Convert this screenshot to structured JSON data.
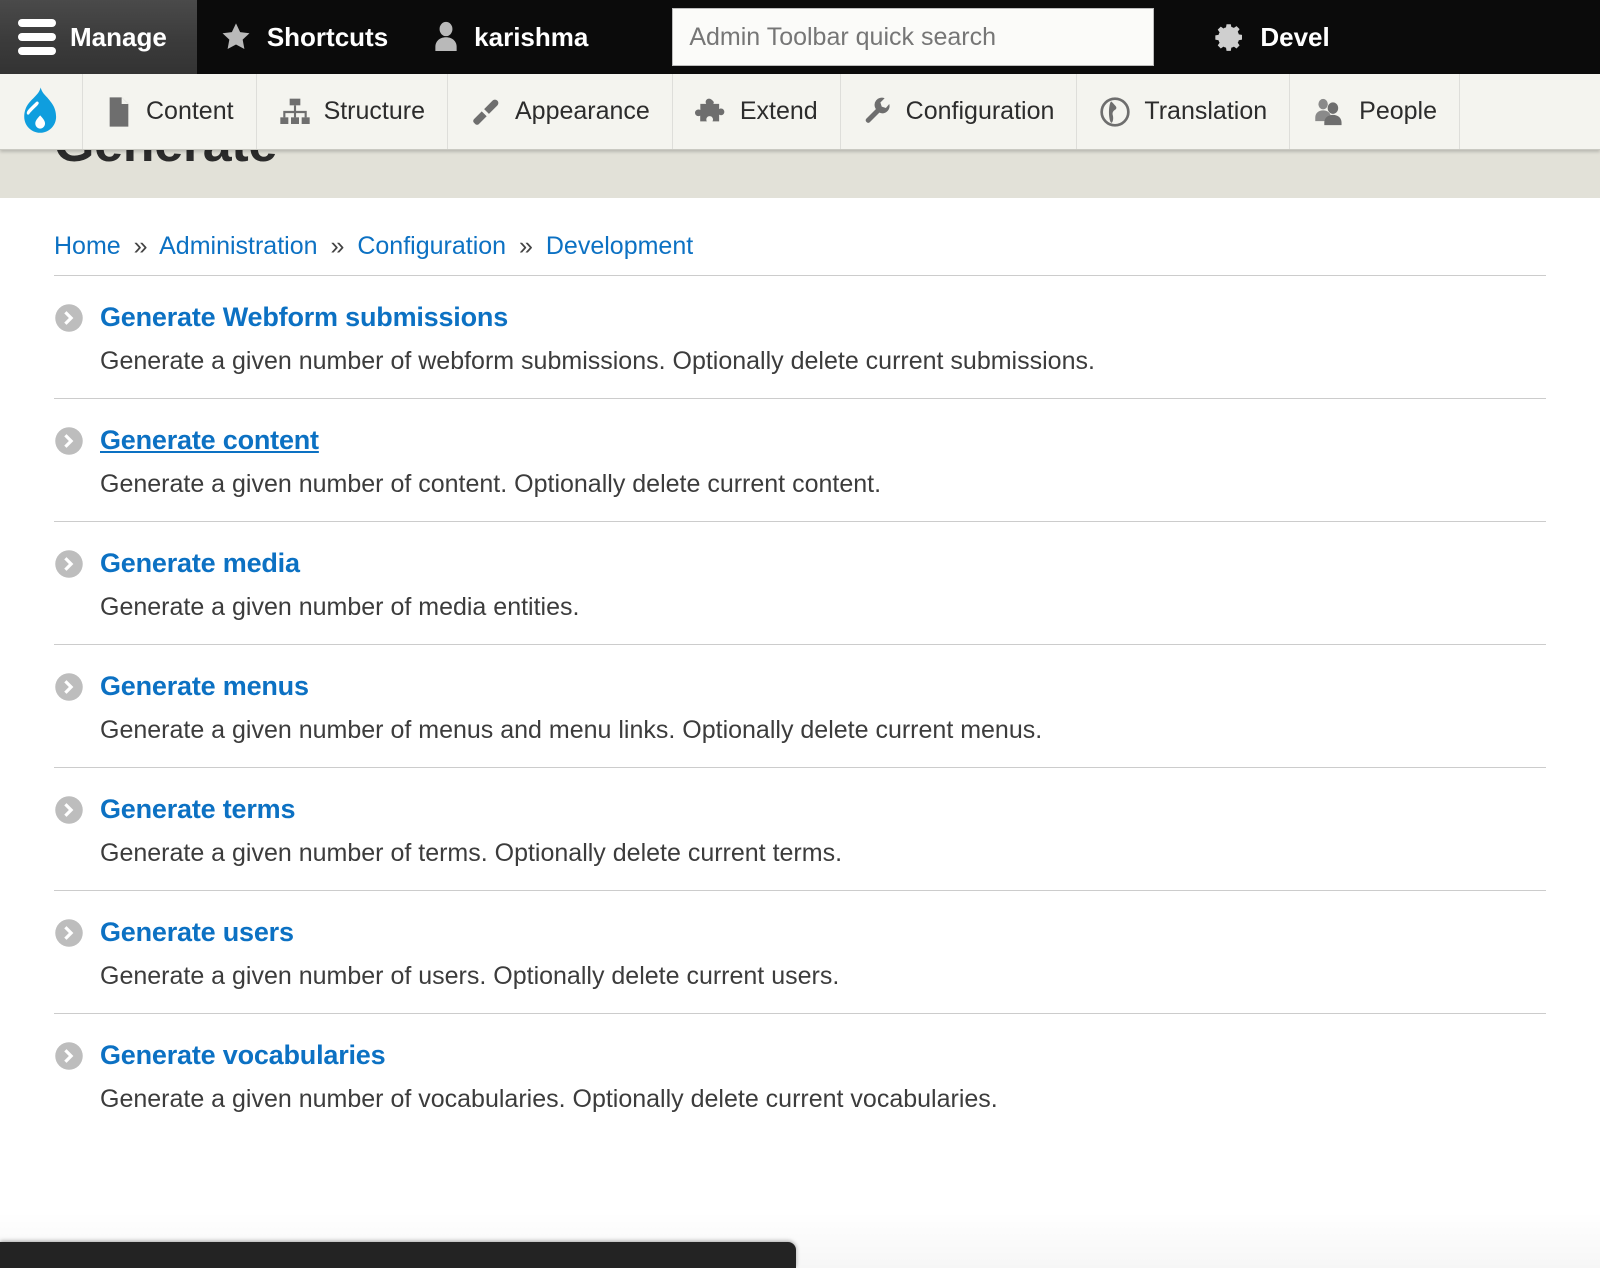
{
  "admin_bar": {
    "manage_label": "Manage",
    "shortcuts_label": "Shortcuts",
    "user_label": "karishma",
    "devel_label": "Devel",
    "search": {
      "placeholder": "Admin Toolbar quick search",
      "value": ""
    }
  },
  "toolbar": {
    "logo_name": "drupal-logo",
    "items": [
      {
        "label": "Content",
        "icon": "content-icon"
      },
      {
        "label": "Structure",
        "icon": "structure-icon"
      },
      {
        "label": "Appearance",
        "icon": "appearance-icon"
      },
      {
        "label": "Extend",
        "icon": "extend-icon"
      },
      {
        "label": "Configuration",
        "icon": "configuration-icon"
      },
      {
        "label": "Translation",
        "icon": "translation-icon"
      },
      {
        "label": "People",
        "icon": "people-icon"
      }
    ]
  },
  "page": {
    "title": "Generate"
  },
  "breadcrumb": {
    "items": [
      {
        "label": "Home"
      },
      {
        "label": "Administration"
      },
      {
        "label": "Configuration"
      },
      {
        "label": "Development"
      }
    ],
    "separator": "»"
  },
  "admin_list": [
    {
      "label": "Generate Webform submissions",
      "description": "Generate a given number of webform submissions. Optionally delete current submissions.",
      "hovered": false
    },
    {
      "label": "Generate content",
      "description": "Generate a given number of content. Optionally delete current content.",
      "hovered": true
    },
    {
      "label": "Generate media",
      "description": "Generate a given number of media entities.",
      "hovered": false
    },
    {
      "label": "Generate menus",
      "description": "Generate a given number of menus and menu links. Optionally delete current menus.",
      "hovered": false
    },
    {
      "label": "Generate terms",
      "description": "Generate a given number of terms. Optionally delete current terms.",
      "hovered": false
    },
    {
      "label": "Generate users",
      "description": "Generate a given number of users. Optionally delete current users.",
      "hovered": false
    },
    {
      "label": "Generate vocabularies",
      "description": "Generate a given number of vocabularies. Optionally delete current vocabularies.",
      "hovered": false
    }
  ],
  "colors": {
    "link_blue": "#0c71c3",
    "drupal_blue": "#0f9ede",
    "admin_bar_bg": "#0b0b0b",
    "toolbar_bg": "#f4f4ef",
    "title_band_bg": "#e2e1d8",
    "bullet_gray": "#bdbdbd"
  }
}
